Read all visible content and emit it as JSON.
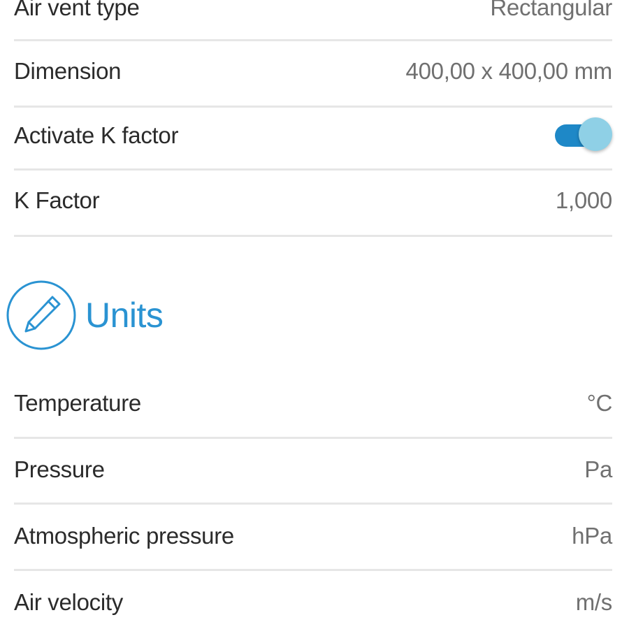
{
  "settings": {
    "air_vent_type": {
      "label": "Air vent type",
      "value": "Rectangular"
    },
    "dimension": {
      "label": "Dimension",
      "value": "400,00 x 400,00 mm"
    },
    "activate_k_factor": {
      "label": "Activate K factor",
      "enabled": true
    },
    "k_factor": {
      "label": "K Factor",
      "value": "1,000"
    }
  },
  "units_section": {
    "title": "Units",
    "icon": "pencil-icon",
    "rows": {
      "temperature": {
        "label": "Temperature",
        "value": "°C"
      },
      "pressure": {
        "label": "Pressure",
        "value": "Pa"
      },
      "atmospheric_pressure": {
        "label": "Atmospheric pressure",
        "value": "hPa"
      },
      "air_velocity": {
        "label": "Air velocity",
        "value": "m/s"
      }
    }
  },
  "colors": {
    "accent": "#2a93d2",
    "toggle_track": "#1e88c7",
    "toggle_thumb": "#8fd0e6",
    "divider": "#e6e6e6",
    "label_text": "#2b2b2b",
    "value_text": "#707070"
  }
}
